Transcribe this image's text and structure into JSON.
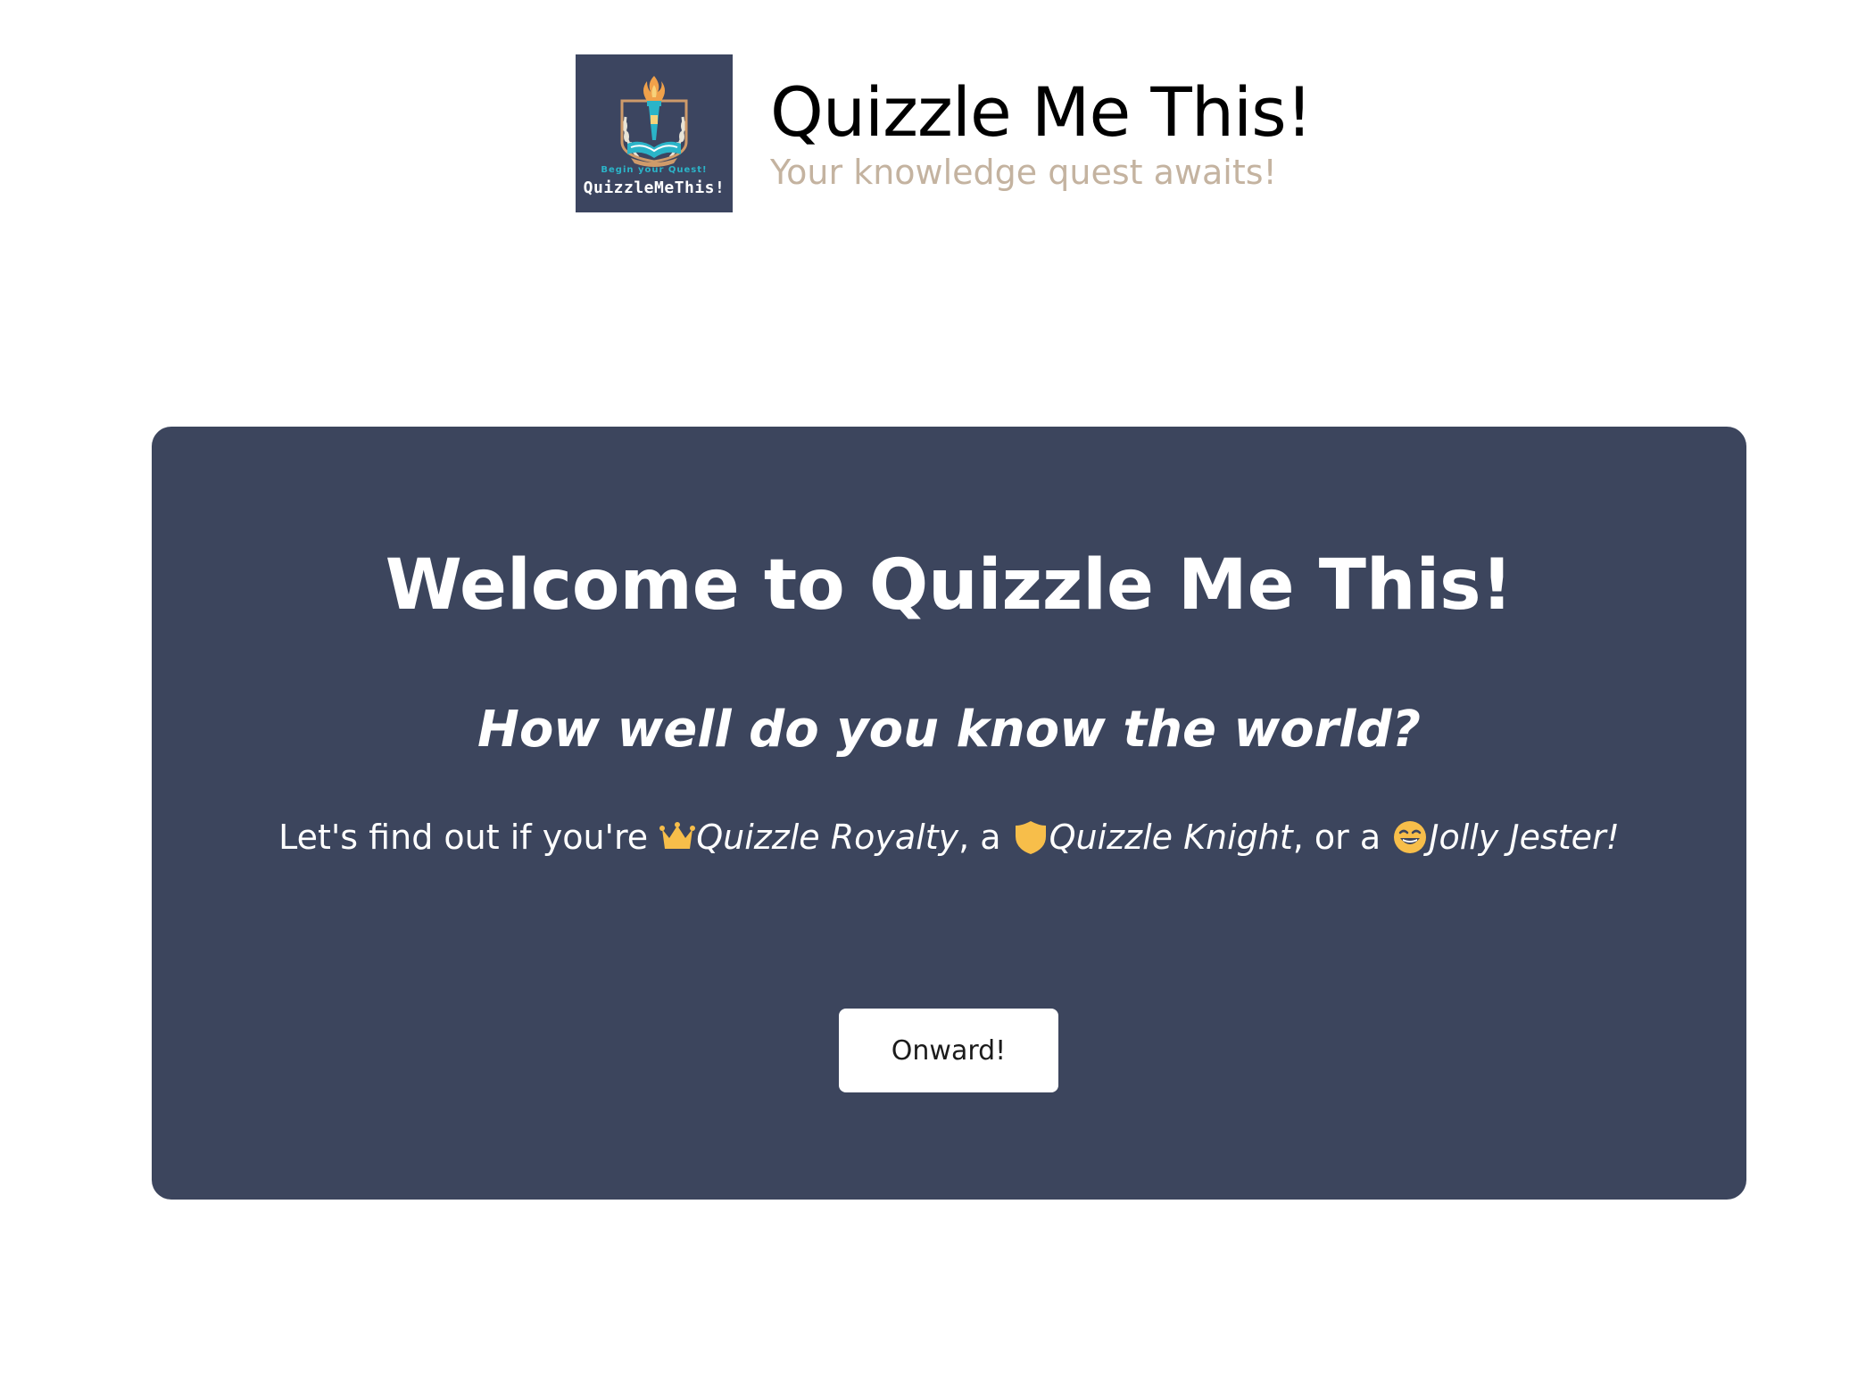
{
  "header": {
    "logo": {
      "tagline": "Begin your Quest!",
      "name": "QuizzleMeThis!",
      "icon": "torch-book-crest-icon",
      "background": "#3c4560"
    },
    "title": "Quizzle Me This!",
    "tagline": "Your knowledge quest awaits!"
  },
  "welcome": {
    "title": "Welcome to Quizzle Me This!",
    "subtitle": "How well do you know the world?",
    "description": {
      "intro": "Let's find out if you're ",
      "royalty_icon": "crown-icon",
      "royalty": "Quizzle Royalty",
      "sep1": ", a ",
      "knight_icon": "shield-icon",
      "knight": "Quizzle Knight",
      "sep2": ", or a ",
      "jester_icon": "grinning-winking-face-icon",
      "jester": "Jolly Jester!"
    },
    "button_label": "Onward!"
  },
  "colors": {
    "card_background": "#3c455d",
    "tagline": "#c4b3a0",
    "accent": "#f7be4a"
  }
}
